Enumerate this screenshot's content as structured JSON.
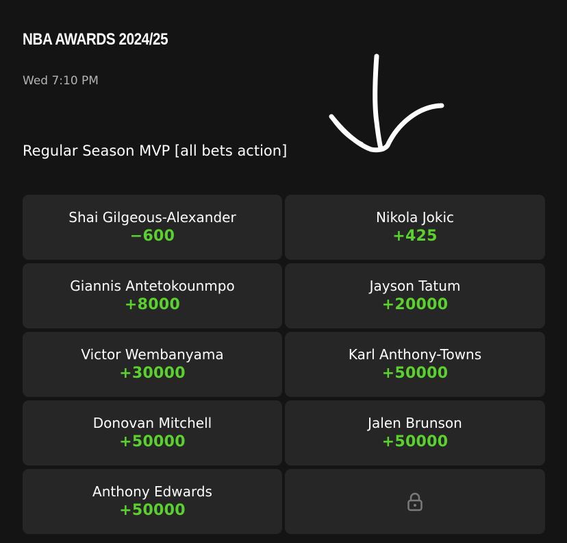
{
  "header": {
    "event_title": "NBA AWARDS 2024/25",
    "event_time": "Wed 7:10 PM"
  },
  "market": {
    "title": "Regular Season MVP [all bets action]"
  },
  "selections": [
    {
      "name": "Shai Gilgeous-Alexander",
      "odds": "−600"
    },
    {
      "name": "Nikola Jokic",
      "odds": "+425"
    },
    {
      "name": "Giannis Antetokounmpo",
      "odds": "+8000"
    },
    {
      "name": "Jayson Tatum",
      "odds": "+20000"
    },
    {
      "name": "Victor Wembanyama",
      "odds": "+30000"
    },
    {
      "name": "Karl Anthony-Towns",
      "odds": "+50000"
    },
    {
      "name": "Donovan Mitchell",
      "odds": "+50000"
    },
    {
      "name": "Jalen Brunson",
      "odds": "+50000"
    },
    {
      "name": "Anthony Edwards",
      "odds": "+50000"
    }
  ],
  "locked_cell": {
    "icon": "lock-icon"
  },
  "annotation": {
    "icon": "hand-drawn-arrow-icon"
  },
  "colors": {
    "background": "#141414",
    "cell": "#262626",
    "odds": "#5ad12f",
    "text": "#ffffff",
    "muted": "#b4b4b4"
  }
}
